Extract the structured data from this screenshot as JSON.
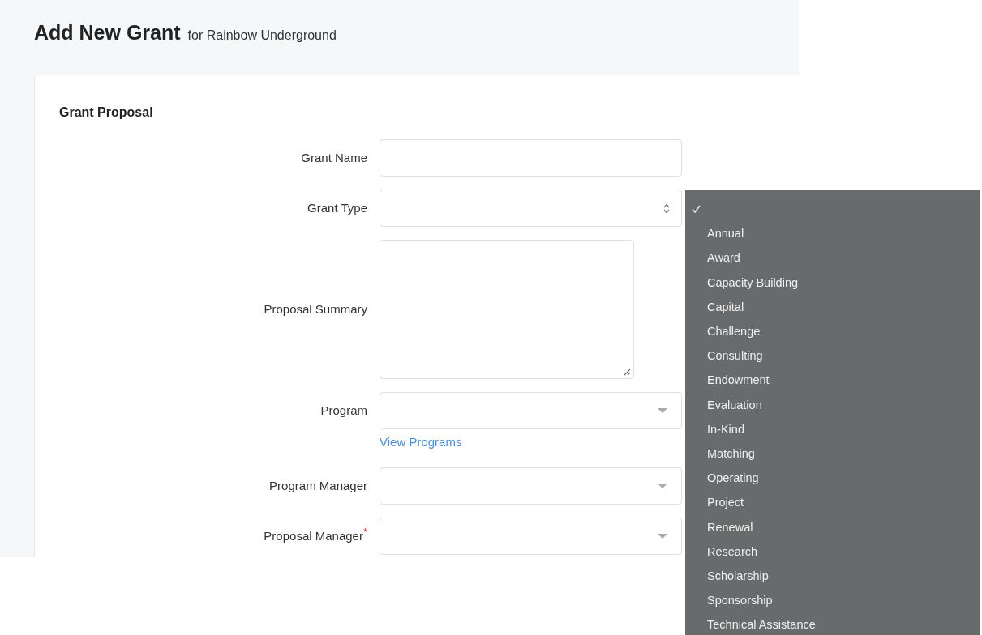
{
  "page": {
    "title": "Add New Grant",
    "subtitle": "for Rainbow Underground"
  },
  "section": {
    "title": "Grant Proposal",
    "fields": [
      {
        "label": "Grant Name",
        "kind": "text"
      },
      {
        "label": "Grant Type",
        "kind": "native-select"
      },
      {
        "label": "Proposal Summary",
        "kind": "textarea"
      },
      {
        "label": "Program",
        "kind": "dropdown",
        "link": "View Programs"
      },
      {
        "label": "Program Manager",
        "kind": "dropdown"
      },
      {
        "label": "Proposal Manager",
        "kind": "dropdown",
        "required_mark": "*"
      }
    ]
  },
  "grant_type_menu": {
    "options": [
      {
        "selected": true
      },
      {
        "label": "Annual",
        "selected": false
      },
      {
        "label": "Award",
        "selected": false
      },
      {
        "label": "Capacity Building",
        "selected": false
      },
      {
        "label": "Capital",
        "selected": false
      },
      {
        "label": "Challenge",
        "selected": false
      },
      {
        "label": "Consulting",
        "selected": false
      },
      {
        "label": "Endowment",
        "selected": false
      },
      {
        "label": "Evaluation",
        "selected": false
      },
      {
        "label": "In-Kind",
        "selected": false
      },
      {
        "label": "Matching",
        "selected": false
      },
      {
        "label": "Operating",
        "selected": false
      },
      {
        "label": "Project",
        "selected": false
      },
      {
        "label": "Renewal",
        "selected": false
      },
      {
        "label": "Research",
        "selected": false
      },
      {
        "label": "Scholarship",
        "selected": false
      },
      {
        "label": "Sponsorship",
        "selected": false
      },
      {
        "label": "Technical Assistance",
        "selected": false
      }
    ]
  }
}
